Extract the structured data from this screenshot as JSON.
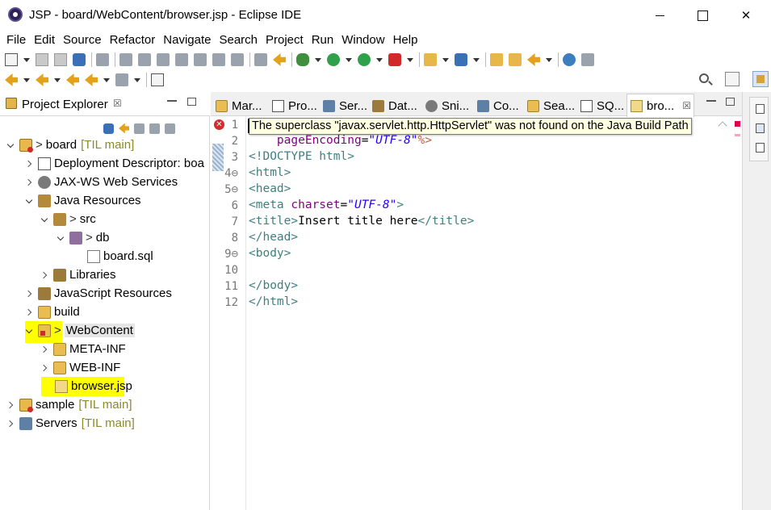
{
  "window": {
    "title": "JSP - board/WebContent/browser.jsp - Eclipse IDE"
  },
  "menu": [
    "File",
    "Edit",
    "Source",
    "Refactor",
    "Navigate",
    "Search",
    "Project",
    "Run",
    "Window",
    "Help"
  ],
  "project_explorer": {
    "title": "Project Explorer",
    "close_glyph": "☒",
    "tree": [
      {
        "label": "board",
        "decoration": "[TIL main]",
        "prefix": ">"
      },
      {
        "label": "Deployment Descriptor: boa"
      },
      {
        "label": "JAX-WS Web Services"
      },
      {
        "label": "Java Resources"
      },
      {
        "label": "src",
        "prefix": ">"
      },
      {
        "label": "db",
        "prefix": ">"
      },
      {
        "label": "board.sql"
      },
      {
        "label": "Libraries"
      },
      {
        "label": "JavaScript Resources"
      },
      {
        "label": "build"
      },
      {
        "label": "WebContent",
        "prefix": ">"
      },
      {
        "label": "META-INF"
      },
      {
        "label": "WEB-INF"
      },
      {
        "label": "browser.jsp"
      },
      {
        "label": "sample",
        "decoration": "[TIL main]"
      },
      {
        "label": "Servers",
        "decoration": "[TIL main]"
      }
    ]
  },
  "editor": {
    "tabs": [
      {
        "label": "Mar..."
      },
      {
        "label": "Pro..."
      },
      {
        "label": "Ser..."
      },
      {
        "label": "Dat..."
      },
      {
        "label": "Sni..."
      },
      {
        "label": "Co..."
      },
      {
        "label": "Sea..."
      },
      {
        "label": "SQ..."
      },
      {
        "label": "bro...",
        "active": true
      }
    ],
    "tab_close_glyph": "☒",
    "line_numbers": [
      "1",
      "2",
      "3",
      "4⊖",
      "5⊖",
      "6",
      "7",
      "8",
      "9⊖",
      "10",
      "11",
      "12"
    ],
    "tooltip": "The superclass \"javax.servlet.http.HttpServlet\" was not found on the Java Build Path",
    "code": {
      "l2_attr": "pageEncoding",
      "l2_eq": "=",
      "l2_val": "\"UTF-8\"",
      "l2_close": "%>",
      "l3": "<!DOCTYPE html>",
      "l4": "<html>",
      "l5": "<head>",
      "l6_open": "<meta",
      "l6_attr": "charset",
      "l6_eq": "=",
      "l6_val": "\"UTF-8\"",
      "l6_close": ">",
      "l7_open": "<title>",
      "l7_text": "Insert title here",
      "l7_close": "</title>",
      "l8": "</head>",
      "l9": "<body>",
      "l11": "</body>",
      "l12": "</html>"
    }
  },
  "colors": {
    "highlight": "#ffff00",
    "error": "#d52b2b"
  }
}
